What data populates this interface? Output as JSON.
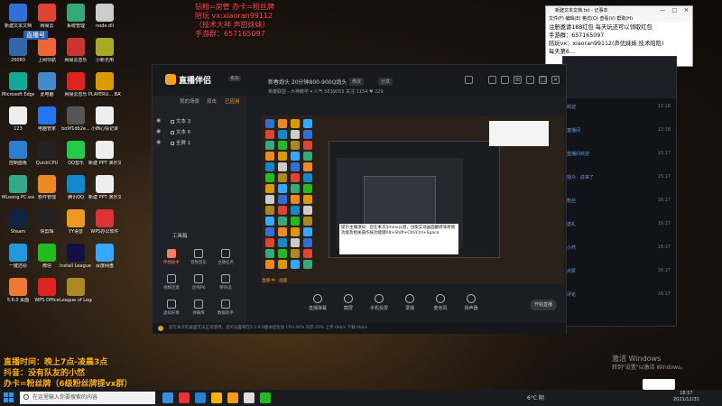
{
  "desktop": {
    "icons": [
      {
        "label": "新建文本文档",
        "color": "#2f6fd6"
      },
      {
        "label": "网易云",
        "color": "#d43"
      },
      {
        "label": "系统管理",
        "color": "#3a7"
      },
      {
        "label": "node.dll",
        "color": "#ccc"
      },
      {
        "label": "20083",
        "color": "#3366aa"
      },
      {
        "label": "上网导航",
        "color": "#e63"
      },
      {
        "label": "网易云音乐",
        "color": "#c33"
      },
      {
        "label": "小新无用",
        "color": "#aa2"
      },
      {
        "label": "Microsoft Edge",
        "color": "#1a9"
      },
      {
        "label": "此电脑",
        "color": "#4488cc"
      },
      {
        "label": "网易云音乐",
        "color": "#d22"
      },
      {
        "label": "PLAYERU... BATTLEGR...",
        "color": "#d90"
      },
      {
        "label": "123",
        "color": "#eee"
      },
      {
        "label": "电脑管家",
        "color": "#2277ee"
      },
      {
        "label": "bo9f1db2e...",
        "color": "#555"
      },
      {
        "label": "小西心情记录",
        "color": "#eee"
      },
      {
        "label": "控制面板",
        "color": "#2a7fd0"
      },
      {
        "label": "QuickCPU",
        "color": "#222"
      },
      {
        "label": "QQ音乐",
        "color": "#2c4"
      },
      {
        "label": "新建 PPT 演示文稿",
        "color": "#eee"
      },
      {
        "label": "MLoong PC.exe",
        "color": "#3a8"
      },
      {
        "label": "软件管理",
        "color": "#e82"
      },
      {
        "label": "腾讯QQ",
        "color": "#18c"
      },
      {
        "label": "新建 PPT 演示文稿",
        "color": "#eee"
      },
      {
        "label": "Steam",
        "color": "#124"
      },
      {
        "label": "快剪辑",
        "color": "#222"
      },
      {
        "label": "YY语音",
        "color": "#e92"
      },
      {
        "label": "WPS办公软件",
        "color": "#d33"
      },
      {
        "label": "一键还原",
        "color": "#2299dd"
      },
      {
        "label": "微信",
        "color": "#2b2"
      },
      {
        "label": "Install League of ...",
        "color": "#114"
      },
      {
        "label": "百度网盘",
        "color": "#3af"
      },
      {
        "label": "5.6.0 桌面",
        "color": "#e73"
      },
      {
        "label": "WPS Office",
        "color": "#d22"
      },
      {
        "label": "League of Legends",
        "color": "#a82"
      }
    ]
  },
  "overlay": {
    "promo_lines": [
      "钻粉=房管 办卡=粉丝牌",
      "陪玩 vx:xiaoran99112",
      "（技术大神 声甜妹妹）",
      "手游群：657165097"
    ],
    "bottom_lines": [
      "直播时间：晚上7点-凌晨3点",
      "抖音：没有队友的小然",
      "办卡=粉丝牌（6级粉丝牌提vx群）"
    ],
    "username_tag": "直播号"
  },
  "notepad": {
    "title": "新建文本文档.txt - 记事本",
    "menu": "文件(F)  编辑(E)  格式(O)  查看(V)  帮助(H)",
    "lines": [
      "注册邀请188红包 每天玩还可以领取红包",
      "手游群：657165097",
      "陪玩vx：xiaoran99112(声优妹妹 技术陪陪)",
      "每天第6..."
    ]
  },
  "chat_panel": {
    "items": [
      {
        "text": "欢迎",
        "time": "12:18"
      },
      {
        "text": "直播间",
        "time": "12:18"
      },
      {
        "text": "直播间欢迎",
        "time": "15:17"
      },
      {
        "text": "观众 · 进来了",
        "time": "15:17"
      },
      {
        "text": "粉丝",
        "time": "16:17"
      },
      {
        "text": "送礼",
        "time": "16:17"
      },
      {
        "text": "小然",
        "time": "16:17"
      },
      {
        "text": "点赞",
        "time": "16:17"
      },
      {
        "text": "评论",
        "time": "16:17"
      }
    ]
  },
  "app": {
    "logo": "直播伴侣",
    "version": "6.0",
    "stream_title": "新春炮头 20分钟800-900Q炮头",
    "edit_btn": "修改",
    "classify_btn": "分享",
    "live_info": "英雄联盟 - 大神教学 ▾   人气 5639055   关注 1154   ♥ 229",
    "tabs": [
      "我的场景",
      "双击",
      "已应用"
    ],
    "scenes": [
      "文本 3",
      "文本 6",
      "全屏 1"
    ],
    "tools_title": "工具箱",
    "tools": [
      {
        "label": "伴唱助手",
        "active": true
      },
      {
        "label": "音频音乐",
        "active": false
      },
      {
        "label": "主播任务",
        "active": false
      },
      {
        "label": "视频连麦",
        "active": false
      },
      {
        "label": "连线PK",
        "active": false
      },
      {
        "label": "特效选",
        "active": false
      },
      {
        "label": "虚拟形象",
        "active": false
      },
      {
        "label": "弹幕库",
        "active": false
      },
      {
        "label": "数据助手",
        "active": false
      }
    ],
    "preview_note": "提示主播须知：您在本次5mins公测，也能实现画面翻转等原始功能及相关操作按功能键Alt+Shift+Ctrl/Ctrl+Space",
    "preview_caption": "直播 中 · 画面",
    "bottom_buttons": [
      "直播弹幕",
      "截屏",
      "手机投屏",
      "录播",
      "麦克风",
      "扬声器"
    ],
    "start_live": "开始直播",
    "status": "您在本次的桌面无法正常使用，您的设置将在5.5.6.0版本后生效  CPU 46% 内存 25% 上传 0kb/s 下载 0kb/s"
  },
  "windows_watermark": {
    "line1": "激活 Windows",
    "line2": "转到\"设置\"以激活 Windows。"
  },
  "taskbar": {
    "search_placeholder": "在这里输入你要搜索的内容",
    "weather": "6°C 阴",
    "time": "18:57",
    "date": "2021/12/31"
  }
}
